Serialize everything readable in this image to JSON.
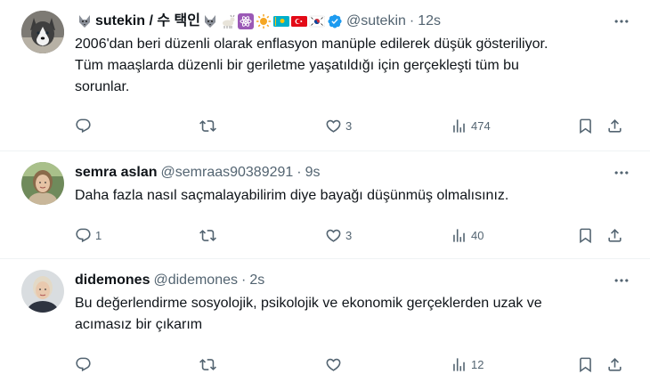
{
  "tweets": [
    {
      "display_name": "sutekin / 수 택인",
      "handle": "@sutekin",
      "time": "12s",
      "text_lines": [
        "2006'dan beri düzenli olarak enflasyon manüple edilerek düşük gösteriliyor.",
        "Tüm maaşlarda düzenli bir geriletme yaşatıldığı için gerçekleşti tüm bu",
        "sorunlar."
      ],
      "replies": "",
      "retweets": "",
      "likes": "3",
      "views": "474",
      "name_emojis": [
        "wolf-icon",
        "goat-icon",
        "atom-icon",
        "sun-icon",
        "kazakhstan-flag-icon",
        "turkey-flag-icon",
        "south-korea-flag-icon",
        "verified-badge-icon"
      ]
    },
    {
      "display_name": "semra aslan",
      "handle": "@semraas90389291",
      "time": "9s",
      "text_lines": [
        "Daha fazla nasıl saçmalayabilirim diye bayağı düşünmüş olmalısınız."
      ],
      "replies": "1",
      "retweets": "",
      "likes": "3",
      "views": "40"
    },
    {
      "display_name": "didemones",
      "handle": "@didemones",
      "time": "2s",
      "text_lines": [
        "Bu değerlendirme sosyolojik, psikolojik ve ekonomik gerçeklerden uzak ve",
        "acımasız bir çıkarım"
      ],
      "replies": "",
      "retweets": "",
      "likes": "",
      "views": "12"
    }
  ],
  "colors": {
    "text": "#0f1419",
    "secondary": "#536471",
    "verified": "#1d9bf0",
    "divider": "#eff3f4"
  }
}
